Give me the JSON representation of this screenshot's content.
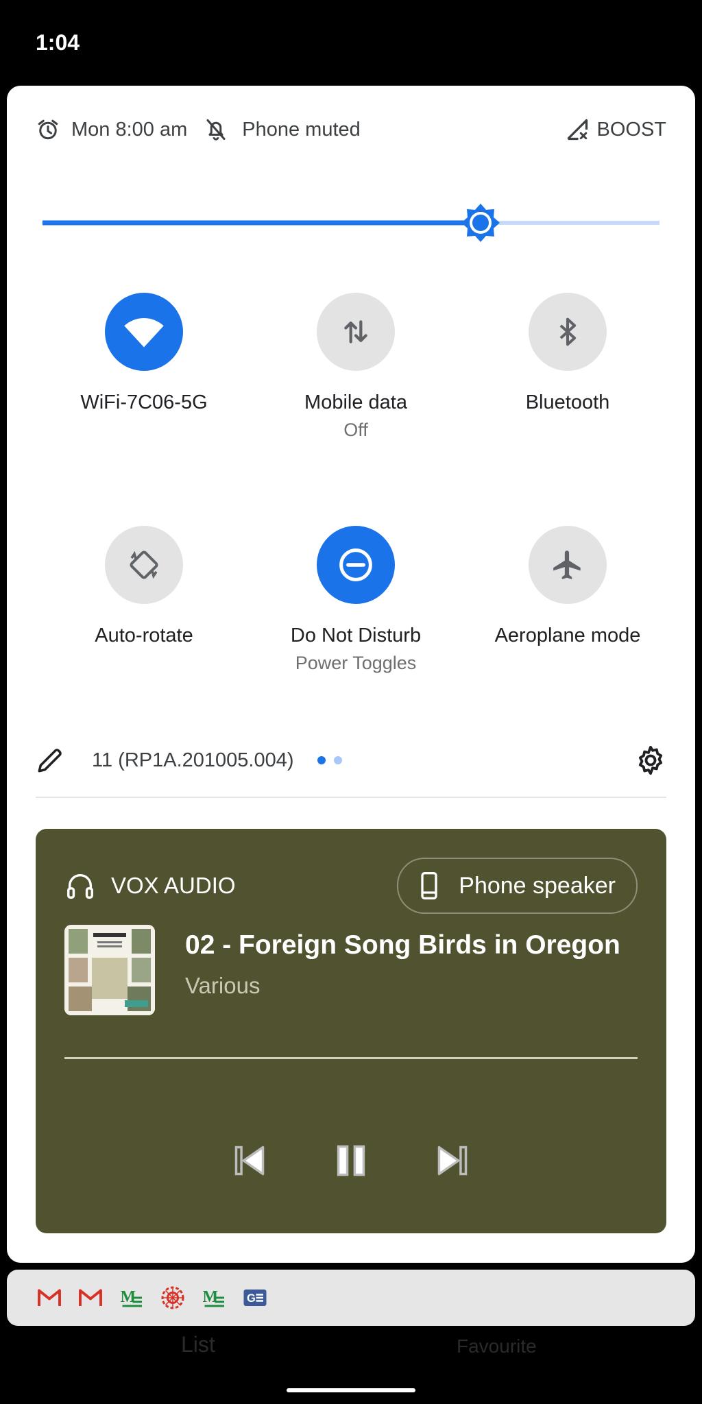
{
  "status_bar": {
    "time": "1:04"
  },
  "header": {
    "alarm": "Mon 8:00 am",
    "ringer": "Phone muted",
    "carrier": "BOOST"
  },
  "brightness": {
    "level_fraction": 0.71
  },
  "tiles": [
    {
      "label": "WiFi-7C06-5G",
      "sub": "",
      "state": "on",
      "icon": "wifi-icon"
    },
    {
      "label": "Mobile data",
      "sub": "Off",
      "state": "off",
      "icon": "mobile-data-icon"
    },
    {
      "label": "Bluetooth",
      "sub": "",
      "state": "off",
      "icon": "bluetooth-icon"
    },
    {
      "label": "Auto-rotate",
      "sub": "",
      "state": "off",
      "icon": "auto-rotate-icon"
    },
    {
      "label": "Do Not Disturb",
      "sub": "Power Toggles",
      "state": "on",
      "icon": "dnd-icon"
    },
    {
      "label": "Aeroplane mode",
      "sub": "",
      "state": "off",
      "icon": "airplane-icon"
    }
  ],
  "footer": {
    "build": "11 (RP1A.201005.004)",
    "page_dots": 2,
    "active_dot": 0
  },
  "media": {
    "app_name": "VOX AUDIO",
    "output_device": "Phone speaker",
    "title": "02 - Foreign Song Birds in Oregon",
    "artist": "Various",
    "background_color": "#515330"
  },
  "dock": {
    "apps": [
      "gmail-icon",
      "gmail-icon",
      "market-watch-icon",
      "target-icon",
      "market-watch-icon",
      "google-contacts-icon"
    ]
  },
  "background_app": {
    "tab_list": "List",
    "tab_favourite": "Favourite"
  },
  "colors": {
    "accent": "#1a73e8",
    "tile_off": "#e3e3e3"
  }
}
